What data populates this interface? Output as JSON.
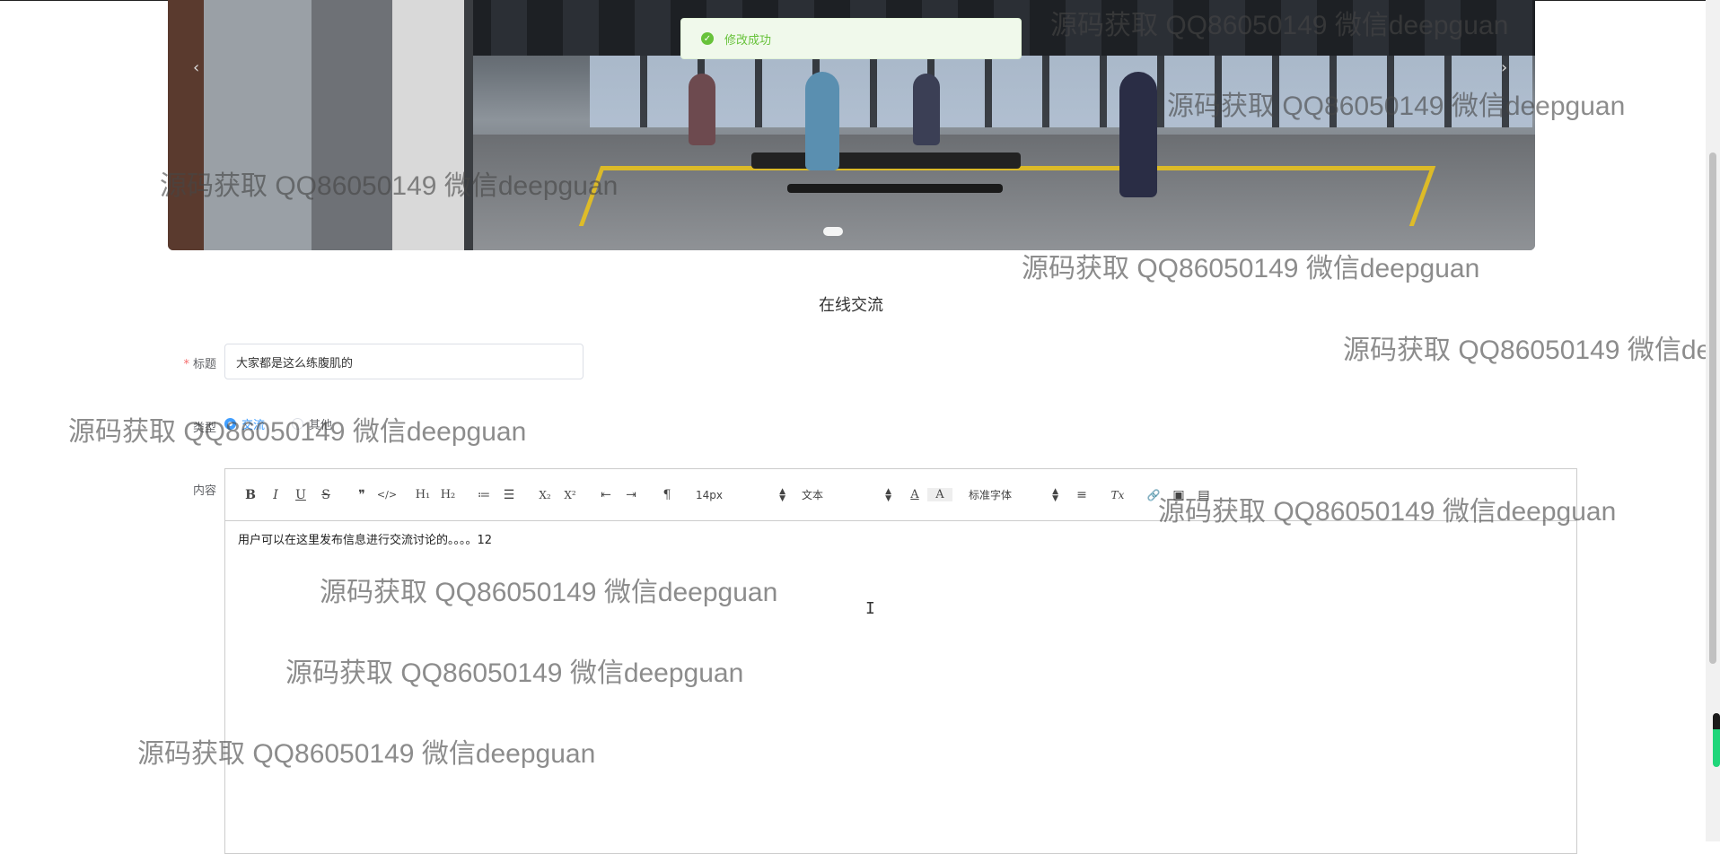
{
  "toast": {
    "message": "修改成功",
    "icon": "check-circle-icon"
  },
  "carousel": {
    "prev_icon": "chevron-left-icon",
    "next_icon": "chevron-right-icon"
  },
  "section_title": "在线交流",
  "form": {
    "title_label": "标题",
    "title_required_mark": "*",
    "title_value": "大家都是这么练腹肌的",
    "type_label": "类型",
    "type_options": [
      "交流",
      "其他"
    ],
    "content_label": "内容"
  },
  "editor": {
    "toolbar": {
      "bold": "B",
      "italic": "I",
      "underline": "U",
      "strike": "S",
      "quote": "❞",
      "code": "</>",
      "h1": "H₁",
      "h2": "H₂",
      "ordered_list": "≔",
      "bullet_list": "☰",
      "subscript": "X₂",
      "superscript": "X²",
      "outdent": "⇤",
      "indent": "⇥",
      "direction": "¶",
      "size": "14px",
      "header": "文本",
      "color": "A",
      "background": "A",
      "font": "标准字体",
      "align": "≡",
      "clean": "Tx",
      "link": "🔗",
      "image": "▣",
      "video": "▤"
    },
    "content": "用户可以在这里发布信息进行交流讨论的。。。。12"
  },
  "watermark": "源码获取 QQ86050149 微信deepguan",
  "colors": {
    "success": "#67c23a",
    "primary": "#409eff",
    "required": "#f56c6c"
  }
}
